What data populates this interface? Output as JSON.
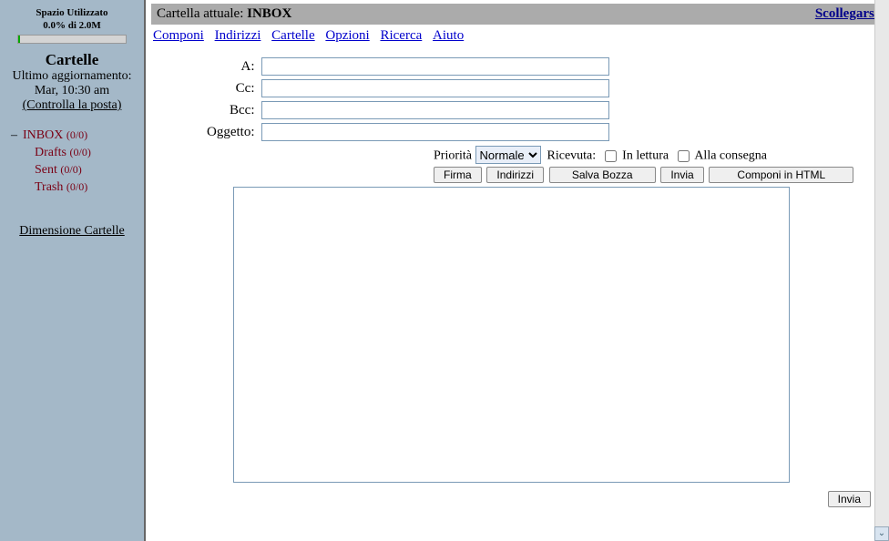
{
  "sidebar": {
    "space_title": "Spazio Utilizzato",
    "space_usage": "0.0% di 2.0M",
    "folders_heading": "Cartelle",
    "last_update_label": "Ultimo aggiornamento:",
    "last_update_time": "Mar, 10:30 am",
    "check_mail_label": "(Controlla la posta)",
    "folders": [
      {
        "name": "INBOX",
        "counts": "(0/0)",
        "active": true
      },
      {
        "name": "Drafts",
        "counts": "(0/0)",
        "active": false
      },
      {
        "name": "Sent",
        "counts": "(0/0)",
        "active": false
      },
      {
        "name": "Trash",
        "counts": "(0/0)",
        "active": false
      }
    ],
    "folder_sizes_label": "Dimensione Cartelle"
  },
  "header": {
    "current_folder_label": "Cartella attuale:",
    "current_folder": "INBOX",
    "logout_label": "Scollegarsi"
  },
  "nav": {
    "links": [
      "Componi",
      "Indirizzi",
      "Cartelle",
      "Opzioni",
      "Ricerca",
      "Aiuto"
    ]
  },
  "compose": {
    "to_label": "A:",
    "cc_label": "Cc:",
    "bcc_label": "Bcc:",
    "subject_label": "Oggetto:",
    "to_value": "",
    "cc_value": "",
    "bcc_value": "",
    "subject_value": "",
    "priority_label": "Priorità",
    "priority_selected": "Normale",
    "priority_options": [
      "Normale"
    ],
    "receipt_label": "Ricevuta:",
    "read_receipt_label": "In lettura",
    "delivery_receipt_label": "Alla consegna",
    "read_receipt_checked": false,
    "delivery_receipt_checked": false,
    "buttons": {
      "signature": "Firma",
      "addresses": "Indirizzi",
      "save_draft": "Salva Bozza",
      "send": "Invia",
      "compose_html": "Componi in HTML"
    },
    "body_value": "",
    "send_bottom": "Invia"
  }
}
